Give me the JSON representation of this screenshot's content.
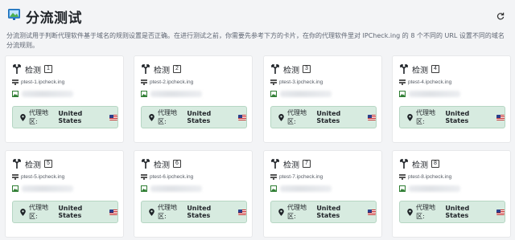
{
  "header": {
    "title": "分流测试",
    "refresh_icon": "refresh-icon",
    "title_icon": "picture-frame-icon"
  },
  "description": "分流测试用于判断代理软件基于域名的规则设置是否正确。在进行测试之前，你需要先参考下方的卡片，在你的代理软件里对 IPCheck.ing 的 8 个不同的 URL 设置不同的域名分流规则。",
  "region_label": "代理地区:",
  "colors": {
    "region_bg": "#d7ebe0",
    "region_border": "#b6d6c3",
    "card_bg": "#ffffff",
    "page_bg": "#f3f4f6"
  },
  "cards": [
    {
      "title": "检测",
      "num": "1",
      "domain": "ptest-1.ipcheck.ing",
      "country": "United States"
    },
    {
      "title": "检测",
      "num": "2",
      "domain": "ptest-2.ipcheck.ing",
      "country": "United States"
    },
    {
      "title": "检测",
      "num": "3",
      "domain": "ptest-3.ipcheck.ing",
      "country": "United States"
    },
    {
      "title": "检测",
      "num": "4",
      "domain": "ptest-4.ipcheck.ing",
      "country": "United States"
    },
    {
      "title": "检测",
      "num": "5",
      "domain": "ptest-5.ipcheck.ing",
      "country": "United States"
    },
    {
      "title": "检测",
      "num": "6",
      "domain": "ptest-6.ipcheck.ing",
      "country": "United States"
    },
    {
      "title": "检测",
      "num": "7",
      "domain": "ptest-7.ipcheck.ing",
      "country": "United States"
    },
    {
      "title": "检测",
      "num": "8",
      "domain": "ptest-8.ipcheck.ing",
      "country": "United States"
    }
  ]
}
